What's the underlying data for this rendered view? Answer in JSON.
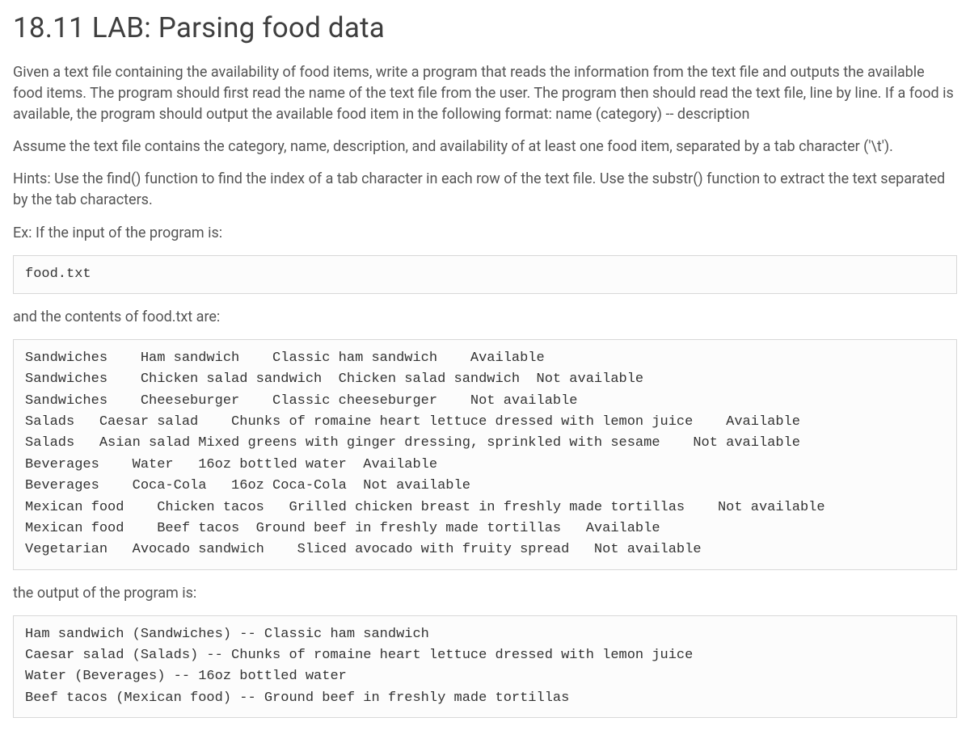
{
  "title": "18.11 LAB: Parsing food data",
  "para1": "Given a text file containing the availability of food items, write a program that reads the information from the text file and outputs the available food items. The program should first read the name of the text file from the user. The program then should read the text file, line by line. If a food is available, the program should output the available food item in the following format: name (category) -- description",
  "para2": "Assume the text file contains the category, name, description, and availability of at least one food item, separated by a tab character ('\\t').",
  "para3": "Hints: Use the find() function to find the index of a tab character in each row of the text file. Use the substr() function to extract the text separated by the tab characters.",
  "para4": "Ex: If the input of the program is:",
  "input_example": "food.txt",
  "para5": "and the contents of food.txt are:",
  "file_contents": "Sandwiches    Ham sandwich    Classic ham sandwich    Available\nSandwiches    Chicken salad sandwich  Chicken salad sandwich  Not available\nSandwiches    Cheeseburger    Classic cheeseburger    Not available\nSalads   Caesar salad    Chunks of romaine heart lettuce dressed with lemon juice    Available\nSalads   Asian salad Mixed greens with ginger dressing, sprinkled with sesame    Not available\nBeverages    Water   16oz bottled water  Available\nBeverages    Coca-Cola   16oz Coca-Cola  Not available\nMexican food    Chicken tacos   Grilled chicken breast in freshly made tortillas    Not available\nMexican food    Beef tacos  Ground beef in freshly made tortillas   Available\nVegetarian   Avocado sandwich    Sliced avocado with fruity spread   Not available",
  "para6": "the output of the program is:",
  "output_example": "Ham sandwich (Sandwiches) -- Classic ham sandwich\nCaesar salad (Salads) -- Chunks of romaine heart lettuce dressed with lemon juice\nWater (Beverages) -- 16oz bottled water\nBeef tacos (Mexican food) -- Ground beef in freshly made tortillas"
}
